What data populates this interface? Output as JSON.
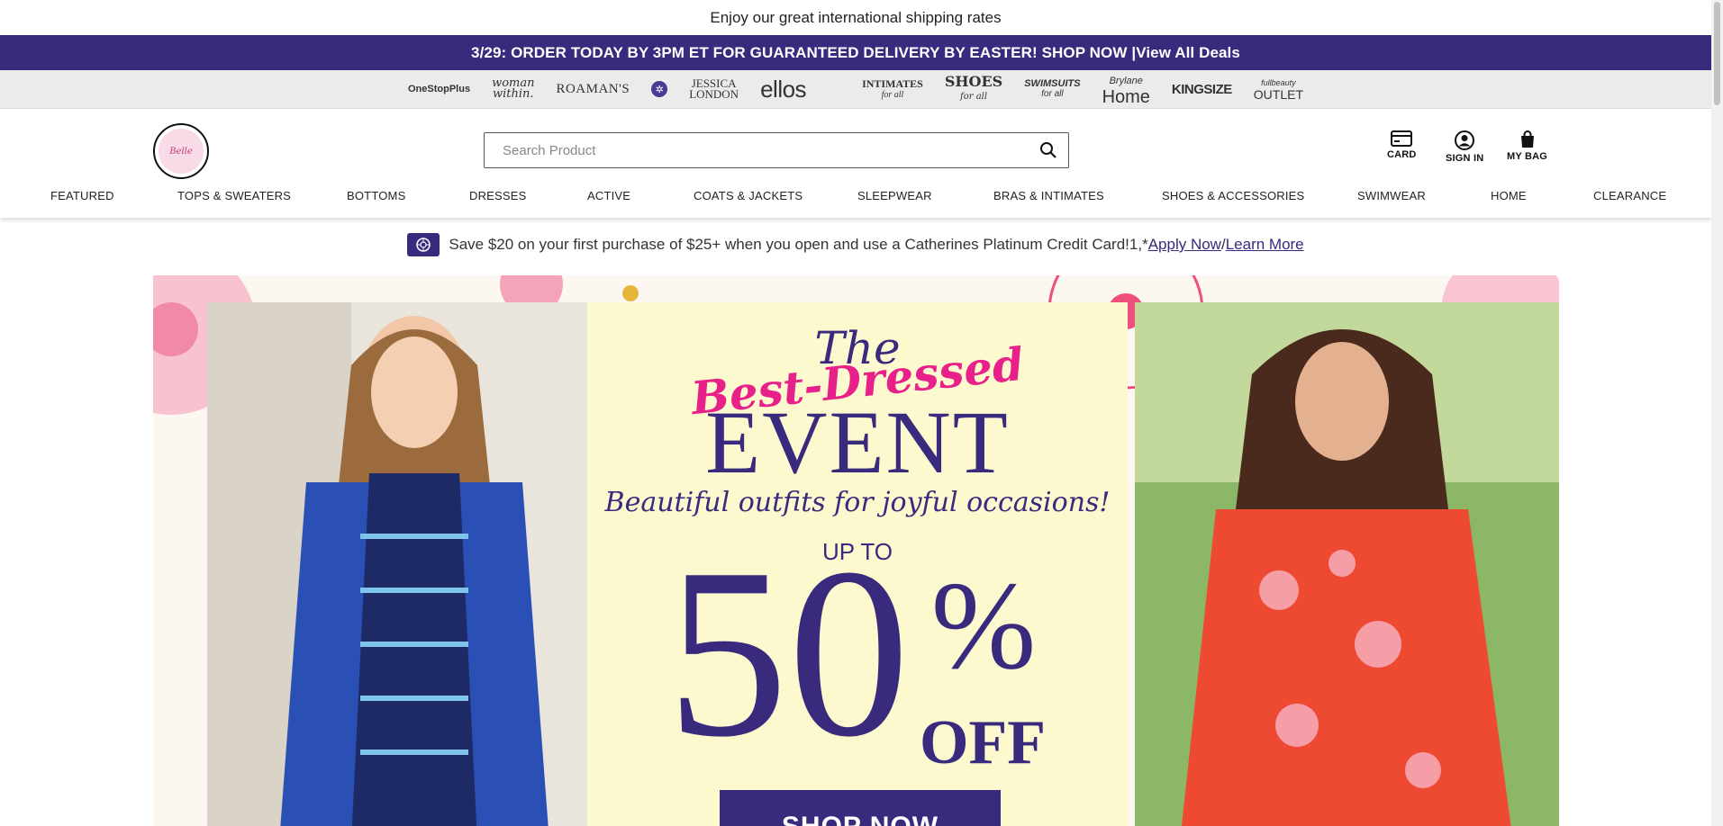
{
  "top_message": "Enjoy our great international shipping rates",
  "promo": {
    "text": "3/29: ORDER TODAY BY 3PM ET FOR GUARANTEED DELIVERY BY EASTER! SHOP NOW | ",
    "link": "View All Deals"
  },
  "brands": {
    "onestopplus": "OneStopPlus",
    "woman_within_1": "woman",
    "woman_within_2": "within.",
    "roamans": "ROAMAN'S",
    "catherines": "✲",
    "jessica_london_1": "JESSICA",
    "jessica_london_2": "LONDON",
    "ellos": "ellos",
    "intimates": "INTIMATES",
    "intimates_sub": "for all",
    "shoes": "SHOES",
    "shoes_sub": "for all",
    "swimsuits": "SWIMSUITS",
    "swimsuits_sub": "for all",
    "brylane_1": "Brylane",
    "brylane_2": "Home",
    "kingsize": "KINGSIZE",
    "fullbeauty_1": "fullbeauty",
    "fullbeauty_2": "OUTLET"
  },
  "header": {
    "logo_text": "Belle",
    "search_placeholder": "Search Product",
    "card_label": "CARD",
    "signin_label": "SIGN IN",
    "bag_label": "MY BAG"
  },
  "nav": [
    "FEATURED",
    "TOPS & SWEATERS",
    "BOTTOMS",
    "DRESSES",
    "ACTIVE",
    "COATS & JACKETS",
    "SLEEPWEAR",
    "BRAS & INTIMATES",
    "SHOES & ACCESSORIES",
    "SWIMWEAR",
    "HOME",
    "CLEARANCE"
  ],
  "credit_offer": {
    "text": "Save $20 on your first purchase of $25+ when you open and use a Catherines Platinum Credit Card!1,*",
    "apply": "Apply Now",
    "sep": "/",
    "learn": "Learn More"
  },
  "hero": {
    "the": "The",
    "best_dressed": "Best-Dressed",
    "event": "EVENT",
    "subtitle": "Beautiful outfits for joyful occasions!",
    "up_to": "UP TO",
    "fifty": "50",
    "percent": "%",
    "off": "OFF",
    "cta": "SHOP NOW"
  },
  "colors": {
    "brand_purple": "#3a2a7e",
    "accent_pink": "#e8208a",
    "hero_yellow": "#fdf9cf"
  }
}
